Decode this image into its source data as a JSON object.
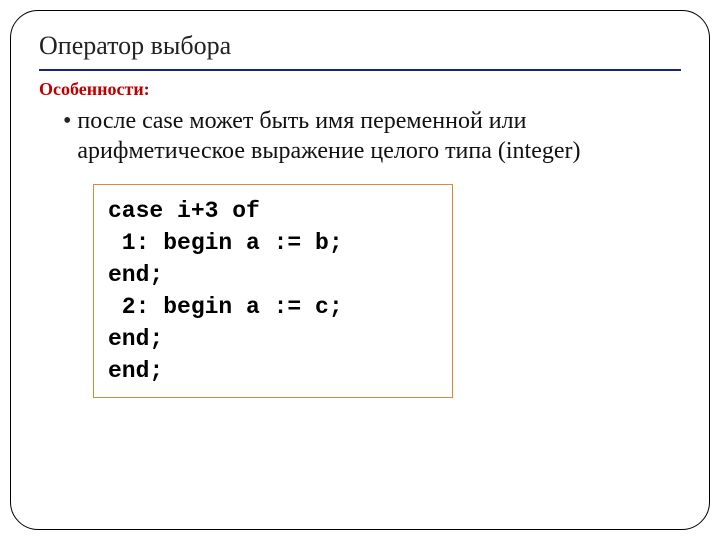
{
  "slide": {
    "title": "Оператор выбора",
    "subtitle": "Особенности:",
    "bullet": "после case может быть имя переменной или арифметическое выражение целого типа (integer)",
    "code": {
      "line1": "case i+3 of",
      "line2": " 1: begin a := b;",
      "line3": "end;",
      "line4": " 2: begin a := c;",
      "line5": "end;",
      "line6": "end;"
    }
  }
}
